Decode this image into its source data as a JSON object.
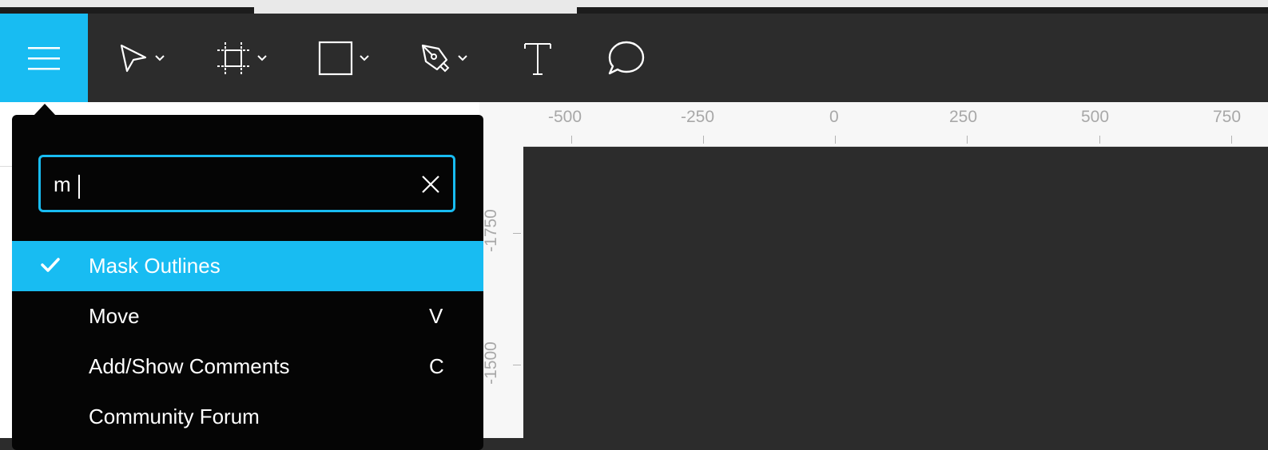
{
  "toolbar": {
    "tools": [
      {
        "name": "select-tool",
        "icon": "pointer-arrow-icon",
        "has_dropdown": true
      },
      {
        "name": "artboard-tool",
        "icon": "artboard-icon",
        "has_dropdown": true
      },
      {
        "name": "rectangle-tool",
        "icon": "rectangle-icon",
        "has_dropdown": true
      },
      {
        "name": "pen-tool",
        "icon": "pen-icon",
        "has_dropdown": true
      },
      {
        "name": "text-tool",
        "icon": "text-icon",
        "has_dropdown": false
      },
      {
        "name": "comment-tool",
        "icon": "speech-bubble-icon",
        "has_dropdown": false
      }
    ],
    "menu_icon": "hamburger-menu-icon"
  },
  "ruler": {
    "top_ticks": [
      "-500",
      "-250",
      "0",
      "250",
      "500",
      "750"
    ],
    "left_ticks": [
      "-1750",
      "-1500"
    ]
  },
  "search": {
    "value": "m",
    "clear_icon": "close-icon"
  },
  "menu": {
    "items": [
      {
        "label": "Mask Outlines",
        "shortcut": "",
        "selected": true
      },
      {
        "label": "Move",
        "shortcut": "V",
        "selected": false
      },
      {
        "label": "Add/Show Comments",
        "shortcut": "C",
        "selected": false
      },
      {
        "label": "Community Forum",
        "shortcut": "",
        "selected": false
      }
    ]
  },
  "colors": {
    "accent": "#18bcf2",
    "toolbar_bg": "#2c2c2c",
    "menu_bg": "#050505",
    "ruler_bg": "#f7f7f7"
  }
}
